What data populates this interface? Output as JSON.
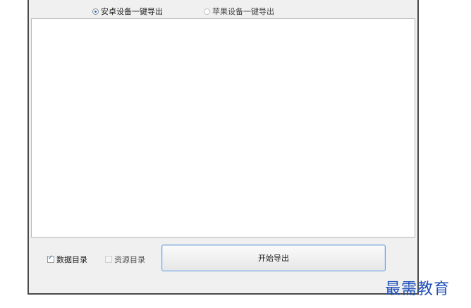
{
  "radios": {
    "android": {
      "label": "安卓设备一键导出",
      "checked": true
    },
    "apple": {
      "label": "苹果设备一键导出",
      "checked": false
    }
  },
  "checkboxes": {
    "data_dir": {
      "label": "数据目录",
      "checked": true
    },
    "resource_dir": {
      "label": "资源目录",
      "checked": false
    }
  },
  "export_button": {
    "label": "开始导出"
  },
  "watermark": "最需教育",
  "colors": {
    "accent": "#2a62c9",
    "button_border": "#6e9fd6",
    "watermark": "#1f4fb8"
  }
}
